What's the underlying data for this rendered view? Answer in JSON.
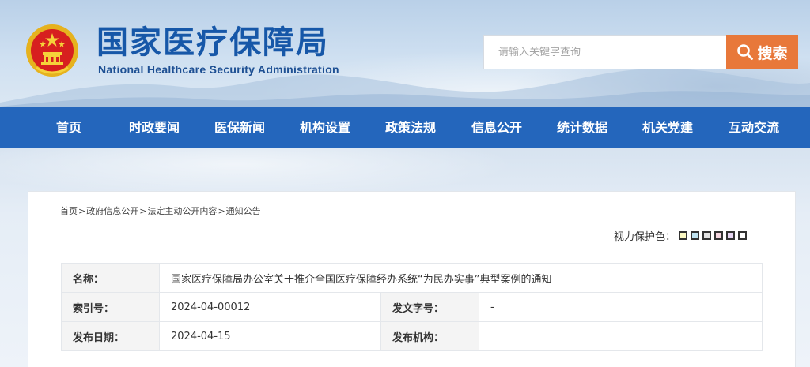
{
  "header": {
    "title": "国家医疗保障局",
    "subtitle": "National Healthcare Security Administration",
    "search": {
      "placeholder": "请输入关键字查询",
      "button_label": "搜索"
    }
  },
  "nav": {
    "items": [
      {
        "label": "首页"
      },
      {
        "label": "时政要闻"
      },
      {
        "label": "医保新闻"
      },
      {
        "label": "机构设置"
      },
      {
        "label": "政策法规"
      },
      {
        "label": "信息公开"
      },
      {
        "label": "统计数据"
      },
      {
        "label": "机关党建"
      },
      {
        "label": "互动交流"
      }
    ]
  },
  "breadcrumb": {
    "items": [
      "首页",
      "政府信息公开",
      "法定主动公开内容",
      "通知公告"
    ],
    "separator": ">"
  },
  "eye_protection": {
    "label": "视力保护色：",
    "swatches": [
      "#fbf8c2",
      "#bfe3f0",
      "#e3e3e3",
      "#f6d6e0",
      "#e7d6f3",
      "#ffffff"
    ]
  },
  "doc_info": {
    "name_label": "名称：",
    "name_value": "国家医疗保障局办公室关于推介全国医疗保障经办系统“为民办实事”典型案例的通知",
    "index_label": "索引号：",
    "index_value": "2024-04-00012",
    "docno_label": "发文字号：",
    "docno_value": "-",
    "date_label": "发布日期：",
    "date_value": "2024-04-15",
    "org_label": "发布机构：",
    "org_value": ""
  },
  "colors": {
    "brand_blue": "#1657a8",
    "nav_blue": "#2466bc",
    "search_orange": "#e8783a"
  }
}
